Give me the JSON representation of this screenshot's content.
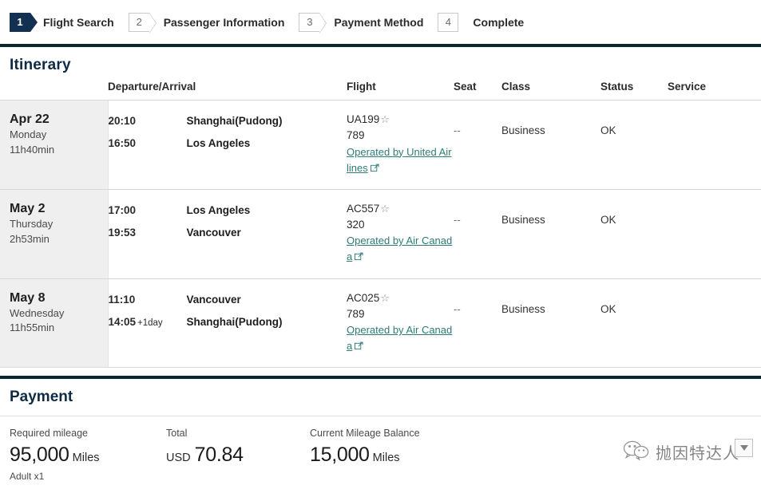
{
  "steps": [
    {
      "num": "1",
      "label": "Flight Search",
      "state": "active"
    },
    {
      "num": "2",
      "label": "Passenger Information",
      "state": "idle"
    },
    {
      "num": "3",
      "label": "Payment Method",
      "state": "idle"
    },
    {
      "num": "4",
      "label": "Complete",
      "state": "plain"
    }
  ],
  "itinerary": {
    "title": "Itinerary",
    "columns": {
      "date": "",
      "departure_arrival": "Departure/Arrival",
      "flight": "Flight",
      "seat": "Seat",
      "class": "Class",
      "status": "Status",
      "service": "Service"
    },
    "rows": [
      {
        "date": "Apr 22",
        "weekday": "Monday",
        "duration": "11h40min",
        "depart_time": "20:10",
        "depart_place": "Shanghai(Pudong)",
        "arrive_time": "16:50",
        "arrive_day_offset": "",
        "arrive_place": "Los Angeles",
        "flight_number": "UA199",
        "star_icon": "star-outline-icon",
        "equipment": "789",
        "operated_by": "Operated by United Airlines",
        "external_icon": "external-link-icon",
        "seat": "--",
        "class": "Business",
        "status": "OK",
        "service": ""
      },
      {
        "date": "May 2",
        "weekday": "Thursday",
        "duration": "2h53min",
        "depart_time": "17:00",
        "depart_place": "Los Angeles",
        "arrive_time": "19:53",
        "arrive_day_offset": "",
        "arrive_place": "Vancouver",
        "flight_number": "AC557",
        "star_icon": "star-outline-icon",
        "equipment": "320",
        "operated_by": "Operated by Air Canada",
        "external_icon": "external-link-icon",
        "seat": "--",
        "class": "Business",
        "status": "OK",
        "service": ""
      },
      {
        "date": "May 8",
        "weekday": "Wednesday",
        "duration": "11h55min",
        "depart_time": "11:10",
        "depart_place": "Vancouver",
        "arrive_time": "14:05",
        "arrive_day_offset": "+1day",
        "arrive_place": "Shanghai(Pudong)",
        "flight_number": "AC025",
        "star_icon": "star-outline-icon",
        "equipment": "789",
        "operated_by": "Operated by Air Canada",
        "external_icon": "external-link-icon",
        "seat": "--",
        "class": "Business",
        "status": "OK",
        "service": ""
      }
    ]
  },
  "payment": {
    "title": "Payment",
    "required_mileage": {
      "label": "Required mileage",
      "value": "95,000",
      "unit": "Miles",
      "sub": "Adult x1"
    },
    "total": {
      "label": "Total",
      "currency": "USD",
      "value": "70.84"
    },
    "current_balance": {
      "label": "Current Mileage Balance",
      "value": "15,000",
      "unit": "Miles"
    }
  },
  "watermark": {
    "icon": "wechat-icon",
    "text": "抛因特达人",
    "dropdown_icon": "triangle-down-icon"
  },
  "colors": {
    "navy": "#0d2432",
    "heading": "#0d2b44",
    "link_teal": "#2e7b78",
    "row_date_bg": "#efefef",
    "step_active_bg": "#143050"
  }
}
